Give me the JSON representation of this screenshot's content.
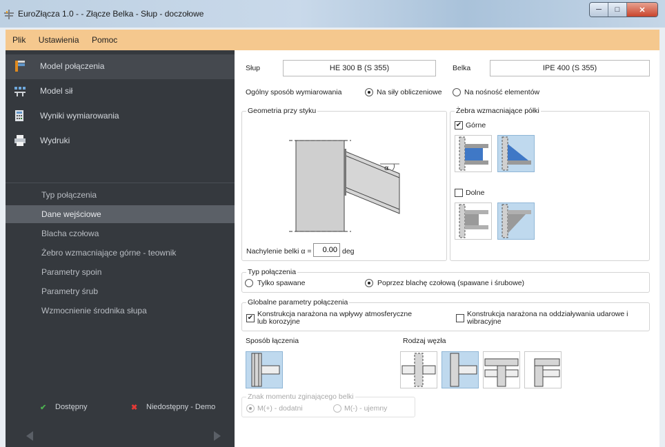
{
  "window": {
    "title": "EuroZłącza 1.0 -  - Złącze Belka - Słup -  doczołowe"
  },
  "menu": [
    "Plik",
    "Ustawienia",
    "Pomoc"
  ],
  "sidebar": {
    "nav": [
      {
        "label": "Model połączenia"
      },
      {
        "label": "Model sił"
      },
      {
        "label": "Wyniki wymiarowania"
      },
      {
        "label": "Wydruki"
      }
    ],
    "steps": [
      {
        "label": "Typ połączenia"
      },
      {
        "label": "Dane wejściowe"
      },
      {
        "label": "Blacha czołowa"
      },
      {
        "label": "Żebro wzmacniające górne - teownik"
      },
      {
        "label": "Parametry spoin"
      },
      {
        "label": "Parametry śrub"
      },
      {
        "label": "Wzmocnienie środnika słupa"
      }
    ],
    "legend": {
      "available": "Dostępny",
      "unavailable": "Niedostępny - Demo"
    },
    "colors": {
      "available": "#4caf50",
      "unavailable": "#e53935"
    }
  },
  "main": {
    "column_label": "Słup",
    "column_value": "HE 300 B (S 355)",
    "beam_label": "Belka",
    "beam_value": "IPE 400 (S 355)",
    "design_label": "Ogólny sposób wymiarowania",
    "design_options": [
      "Na siły obliczeniowe",
      "Na nośność elementów"
    ],
    "geometry_title": "Geometria przy styku",
    "alpha_symbol": "α",
    "inclination_label": "Nachylenie belki α =",
    "inclination_value": "0.00",
    "inclination_unit": "deg",
    "ribs_title": "Żebra wzmacniające półki",
    "ribs_top": "Górne",
    "ribs_bottom": "Dolne",
    "conn_type_title": "Typ połączenia",
    "conn_type_options": [
      "Tylko spawane",
      "Poprzez blachę czołową (spawane i śrubowe)"
    ],
    "global_title": "Globalne parametry połączenia",
    "global_opt1": "Konstrukcja narażona na wpływy atmosferyczne lub korozyjne",
    "global_opt2": "Konstrukcja narażona na oddziaływania udarowe i wibracyjne",
    "join_method_label": "Sposób łączenia",
    "node_type_label": "Rodzaj węzła",
    "moment_title": "Znak momentu zginającego belki",
    "moment_options": [
      "M(+) - dodatni",
      "M(-) - ujemny"
    ]
  }
}
